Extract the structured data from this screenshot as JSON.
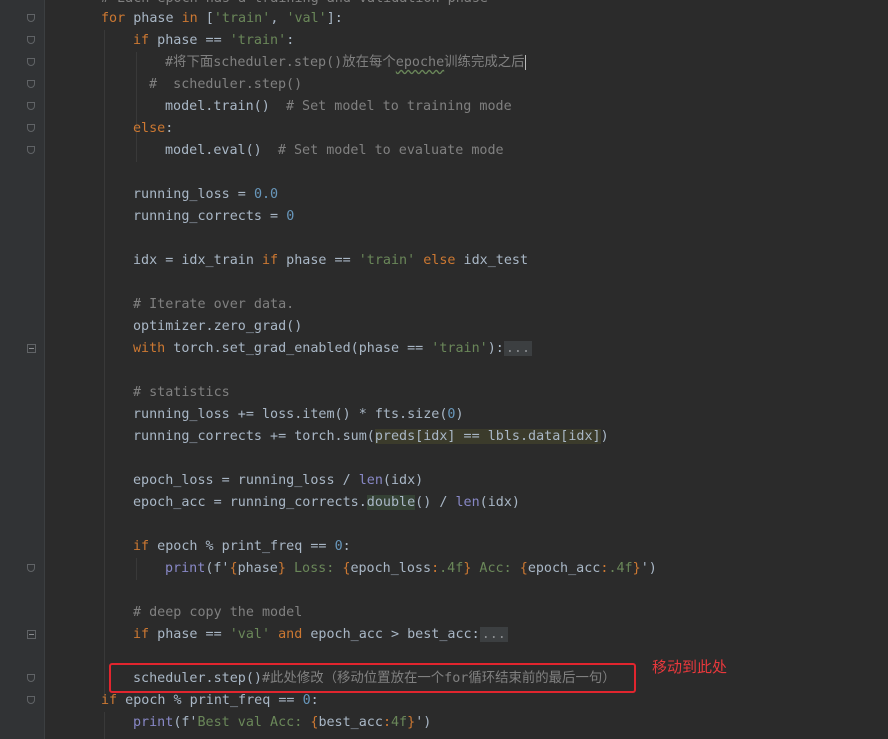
{
  "editor": {
    "lines": [
      {
        "segs": [
          [
            "cmt",
            "# Each epoch has a training and validation phase"
          ]
        ]
      },
      {
        "segs": [
          [
            "kw",
            "for"
          ],
          [
            "fv",
            " phase "
          ],
          [
            "kw",
            "in"
          ],
          [
            "fv",
            " ["
          ],
          [
            "str",
            "'train'"
          ],
          [
            "fv",
            ", "
          ],
          [
            "str",
            "'val'"
          ],
          [
            "fv",
            "]:"
          ]
        ]
      },
      {
        "segs": [
          [
            "kw",
            "if"
          ],
          [
            "fv",
            " phase == "
          ],
          [
            "str",
            "'train'"
          ],
          [
            "fv",
            ":"
          ]
        ]
      },
      {
        "segs": [
          [
            "cmt",
            "#将下面scheduler.step()放在每个"
          ],
          [
            "cmt squiggle",
            "epoche"
          ],
          [
            "cmt",
            "训练完成之后"
          ]
        ]
      },
      {
        "segs": [
          [
            "cmt",
            "#  scheduler.step()"
          ]
        ]
      },
      {
        "segs": [
          [
            "fv",
            "model.train()  "
          ],
          [
            "cmt",
            "# Set model to training mode"
          ]
        ]
      },
      {
        "segs": [
          [
            "kw",
            "else"
          ],
          [
            "fv",
            ":"
          ]
        ]
      },
      {
        "segs": [
          [
            "fv",
            "model.eval()  "
          ],
          [
            "cmt",
            "# Set model to evaluate mode"
          ]
        ]
      },
      {
        "segs": []
      },
      {
        "segs": [
          [
            "fv",
            "running_loss = "
          ],
          [
            "num",
            "0.0"
          ]
        ]
      },
      {
        "segs": [
          [
            "fv",
            "running_corrects = "
          ],
          [
            "num",
            "0"
          ]
        ]
      },
      {
        "segs": []
      },
      {
        "segs": [
          [
            "fv",
            "idx = idx_train "
          ],
          [
            "kw",
            "if"
          ],
          [
            "fv",
            " phase == "
          ],
          [
            "str",
            "'train'"
          ],
          [
            "fv",
            " "
          ],
          [
            "kw",
            "else"
          ],
          [
            "fv",
            " idx_test"
          ]
        ]
      },
      {
        "segs": []
      },
      {
        "segs": [
          [
            "cmt",
            "# Iterate over data."
          ]
        ]
      },
      {
        "segs": [
          [
            "fv",
            "optimizer.zero_grad()"
          ]
        ]
      },
      {
        "segs": [
          [
            "kw",
            "with"
          ],
          [
            "fv",
            " torch.set_grad_enabled(phase == "
          ],
          [
            "str",
            "'train'"
          ],
          [
            "fv",
            "):"
          ],
          [
            "fold-dots",
            "..."
          ]
        ]
      },
      {
        "segs": []
      },
      {
        "segs": [
          [
            "cmt",
            "# statistics"
          ]
        ]
      },
      {
        "segs": [
          [
            "fv",
            "running_loss += loss.item() * fts.size("
          ],
          [
            "num",
            "0"
          ],
          [
            "fv",
            ")"
          ]
        ]
      },
      {
        "segs": [
          [
            "fv",
            "running_corrects += torch.sum("
          ],
          [
            "hl",
            "preds[idx] == lbls.data[idx]"
          ],
          [
            "fv",
            ")"
          ]
        ]
      },
      {
        "segs": []
      },
      {
        "segs": [
          [
            "fv",
            "epoch_loss = running_loss / "
          ],
          [
            "builtin",
            "len"
          ],
          [
            "fv",
            "(idx)"
          ]
        ]
      },
      {
        "segs": [
          [
            "fv",
            "epoch_acc = running_corrects."
          ],
          [
            "hl2",
            "double"
          ],
          [
            "fv",
            "() / "
          ],
          [
            "builtin",
            "len"
          ],
          [
            "fv",
            "(idx)"
          ]
        ]
      },
      {
        "segs": []
      },
      {
        "segs": [
          [
            "kw",
            "if"
          ],
          [
            "fv",
            " epoch % print_freq == "
          ],
          [
            "num",
            "0"
          ],
          [
            "fv",
            ":"
          ]
        ]
      },
      {
        "segs": [
          [
            "builtin",
            "print"
          ],
          [
            "fv",
            "(f'"
          ],
          [
            "kw",
            "{"
          ],
          [
            "fv",
            "phase"
          ],
          [
            "kw",
            "}"
          ],
          [
            "str",
            " Loss: "
          ],
          [
            "kw",
            "{"
          ],
          [
            "fv",
            "epoch_loss"
          ],
          [
            "kw",
            ":"
          ],
          [
            "str",
            ".4f"
          ],
          [
            "kw",
            "}"
          ],
          [
            "str",
            " Acc: "
          ],
          [
            "kw",
            "{"
          ],
          [
            "fv",
            "epoch_acc"
          ],
          [
            "kw",
            ":"
          ],
          [
            "str",
            ".4f"
          ],
          [
            "kw",
            "}"
          ],
          [
            "fv",
            "')"
          ]
        ]
      },
      {
        "segs": []
      },
      {
        "segs": [
          [
            "cmt",
            "# deep copy the model"
          ]
        ]
      },
      {
        "segs": [
          [
            "kw",
            "if"
          ],
          [
            "fv",
            " phase == "
          ],
          [
            "str",
            "'val'"
          ],
          [
            "fv",
            " "
          ],
          [
            "kw",
            "and"
          ],
          [
            "fv",
            " epoch_acc > best_acc:"
          ],
          [
            "fold-dots",
            "..."
          ]
        ]
      },
      {
        "segs": []
      },
      {
        "segs": [
          [
            "fv",
            "scheduler.step()"
          ],
          [
            "cmt",
            "#此处修改（移动位置放在一个for循环结束前的最后一句）"
          ]
        ]
      },
      {
        "segs": [
          [
            "kw",
            "if"
          ],
          [
            "fv",
            " epoch % print_freq == "
          ],
          [
            "num",
            "0"
          ],
          [
            "fv",
            ":"
          ]
        ]
      },
      {
        "segs": [
          [
            "builtin",
            "print"
          ],
          [
            "fv",
            "(f'"
          ],
          [
            "str",
            "Best val Acc: "
          ],
          [
            "kw",
            "{"
          ],
          [
            "fv",
            "best_acc"
          ],
          [
            "kw",
            ":"
          ],
          [
            "str",
            "4f"
          ],
          [
            "kw",
            "}"
          ],
          [
            "fv",
            "')"
          ]
        ]
      }
    ]
  },
  "annotation": {
    "label": "移动到此处",
    "color": "#e1252e"
  }
}
